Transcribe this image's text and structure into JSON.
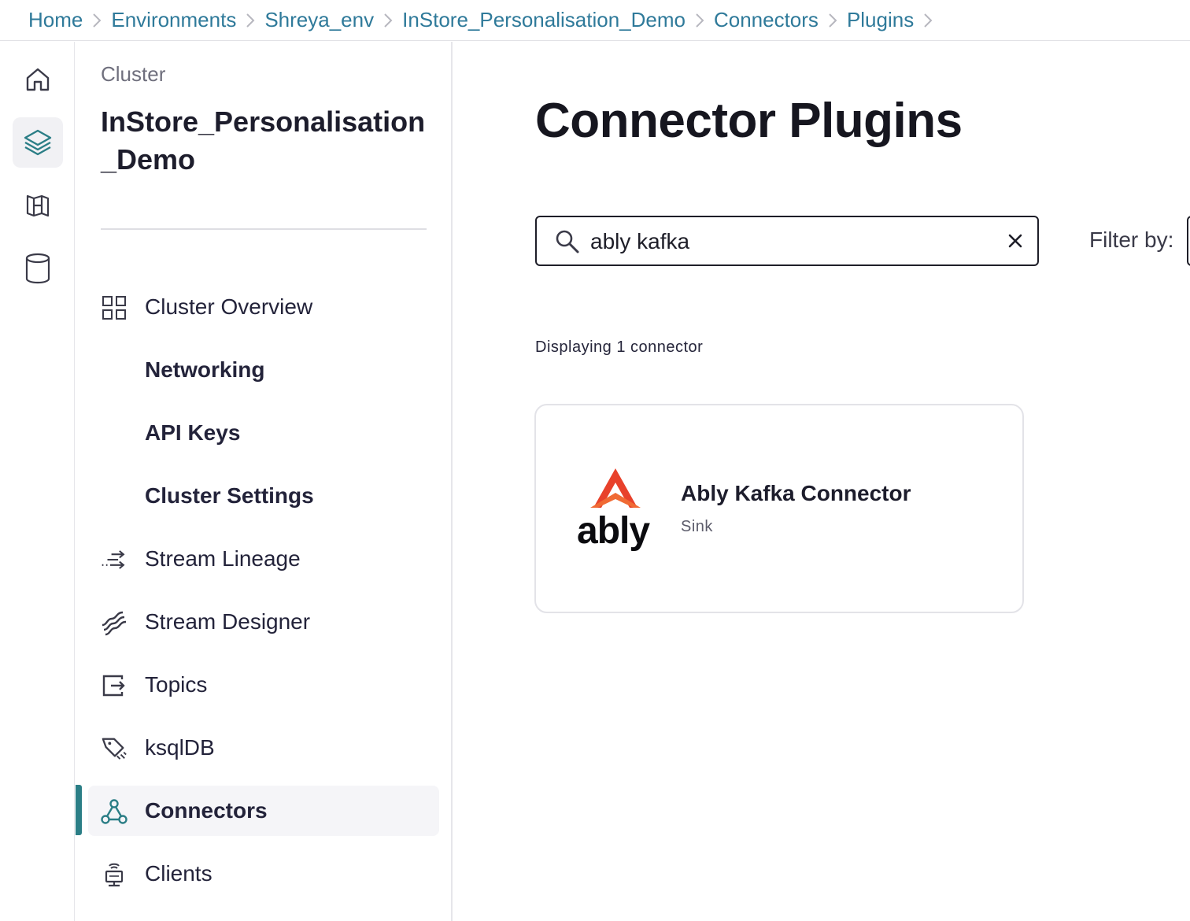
{
  "breadcrumb": [
    {
      "label": "Home"
    },
    {
      "label": "Environments"
    },
    {
      "label": "Shreya_env"
    },
    {
      "label": "InStore_Personalisation_Demo"
    },
    {
      "label": "Connectors"
    },
    {
      "label": "Plugins"
    }
  ],
  "rail": {
    "items": [
      "home-icon",
      "layers-icon",
      "map-icon",
      "database-icon"
    ],
    "active": "layers-icon"
  },
  "sidebar": {
    "label": "Cluster",
    "title": "InStore_Personalisation_Demo",
    "items": [
      {
        "label": "Cluster Overview",
        "icon": "grid-icon"
      },
      {
        "label": "Networking"
      },
      {
        "label": "API Keys"
      },
      {
        "label": "Cluster Settings"
      },
      {
        "label": "Stream Lineage",
        "icon": "stream-lineage-icon"
      },
      {
        "label": "Stream Designer",
        "icon": "stream-designer-icon"
      },
      {
        "label": "Topics",
        "icon": "topics-icon"
      },
      {
        "label": "ksqlDB",
        "icon": "ksqldb-icon"
      },
      {
        "label": "Connectors",
        "icon": "connectors-icon",
        "active": true
      },
      {
        "label": "Clients",
        "icon": "clients-icon"
      }
    ]
  },
  "main": {
    "title": "Connector Plugins",
    "search": {
      "value": "ably kafka"
    },
    "filter_label": "Filter by:",
    "count_text": "Displaying 1 connector",
    "cards": [
      {
        "logo_text": "ably",
        "title": "Ably Kafka Connector",
        "type": "Sink"
      }
    ]
  },
  "colors": {
    "link": "#2f7a9a",
    "accent": "#2b7e86",
    "ably_red": "#e8412b"
  }
}
